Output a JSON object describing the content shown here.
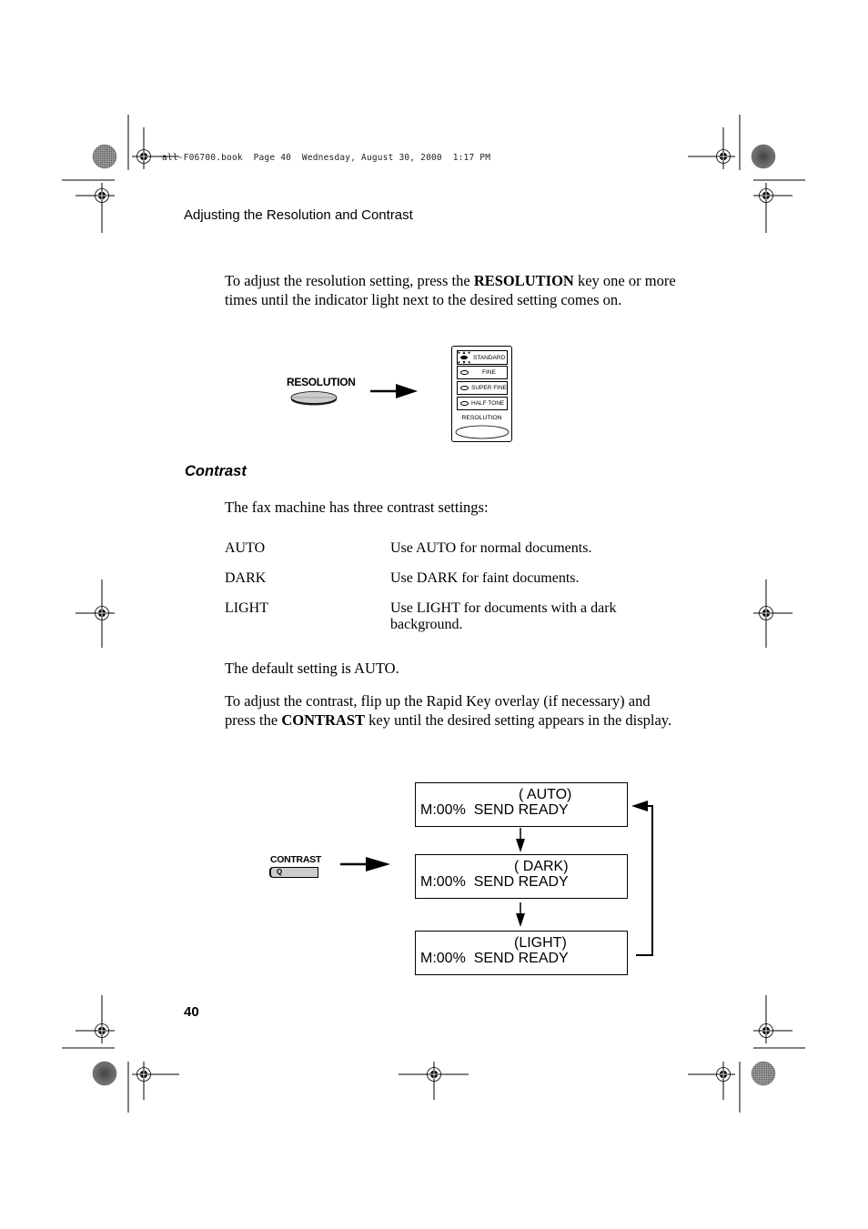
{
  "print_header": {
    "filename": "all-F06700.book",
    "page_label": "Page 40",
    "date": "Wednesday, August 30, 2000",
    "time": "1:17 PM"
  },
  "section_header": "Adjusting the Resolution and Contrast",
  "resolution": {
    "intro": {
      "before": "To adjust the resolution setting, press the ",
      "bold": "RESOLUTION",
      "after": " key one or more times until the indicator light next to the desired setting comes on."
    },
    "key_label": "RESOLUTION",
    "panel": {
      "options": [
        "STANDARD",
        "FINE",
        "SUPER FINE",
        "HALF TONE"
      ],
      "active": "STANDARD",
      "label": "RESOLUTION"
    }
  },
  "contrast": {
    "heading": "Contrast",
    "intro": "The fax machine has three contrast settings:",
    "settings": [
      {
        "term": "AUTO",
        "description": "Use AUTO for normal documents."
      },
      {
        "term": "DARK",
        "description": "Use DARK for faint documents."
      },
      {
        "term": "LIGHT",
        "description": "Use LIGHT for documents with a dark background."
      }
    ],
    "default_note": "The default setting is AUTO.",
    "instructions": {
      "before": "To adjust the contrast, flip up the Rapid Key overlay (if necessary) and press the ",
      "bold": "CONTRAST",
      "after": " key until the desired setting appears in the display."
    },
    "key_label": "CONTRAST",
    "key_glyph": "Q",
    "displays": [
      {
        "mode": "( AUTO)",
        "status": "M:00%  SEND READY"
      },
      {
        "mode": "( DARK)",
        "status": "M:00%  SEND READY"
      },
      {
        "mode": "(LIGHT)",
        "status": "M:00%  SEND READY"
      }
    ]
  },
  "page_number": "40"
}
